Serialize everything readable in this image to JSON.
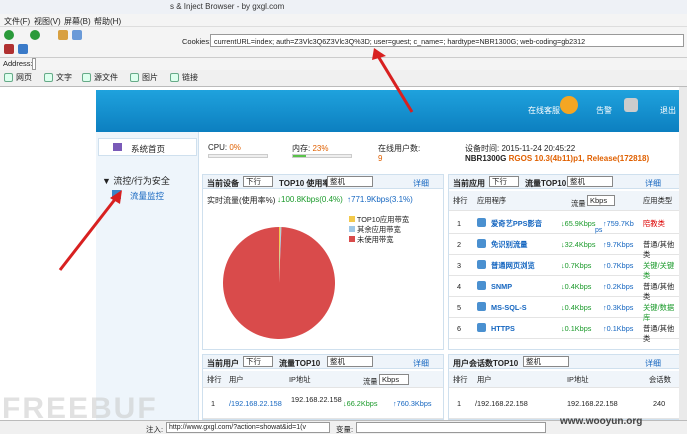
{
  "window_title": "s & Inject Browser - by gxgl.com",
  "menu": [
    "文件(F)",
    "视图(V)",
    "屏幕(B)",
    "帮助(H)"
  ],
  "cookies_label": "Cookies:",
  "cookies_value": "currentURL=index; auth=Z3Vlc3Q6Z3Vlc3Q%3D; user=guest; c_name=; hardtype=NBR1300G; web-coding=gb2312",
  "address_label": "Address:",
  "tabs": [
    "网页",
    "文字",
    "源文件",
    "图片",
    "链接"
  ],
  "banner": {
    "online": "在线客服",
    "alarm": "告警",
    "logout": "退出"
  },
  "sidebar": {
    "home": "系统首页",
    "section": "流控/行为安全",
    "item": "流量监控"
  },
  "stats": {
    "cpu_label": "CPU:",
    "cpu_val": "0%",
    "mem_label": "内存:",
    "mem_val": "23%",
    "users_label": "在线用户数:",
    "users_val": "9",
    "time_label": "设备时间:",
    "time_val": "2015-11-24 20:45:22",
    "model": "NBR1300G",
    "version": "RGOS 10.3(4b11)p1, Release(172818)"
  },
  "progress": {
    "cpu": 0,
    "mem": 23
  },
  "p1": {
    "title": "当前设备",
    "sel1": "下行",
    "top": "TOP10 使用率",
    "sel2": "整机",
    "detail": "详细",
    "realtime": "实时流量(使用率%)",
    "down": "↓100.8Kbps(0.4%)",
    "up": "↑771.9Kbps(3.1%)",
    "legend": [
      "TOP10应用带宽",
      "其余应用带宽",
      "未使用带宽"
    ],
    "legend_colors": [
      "#f2c94c",
      "#9ec7e6",
      "#d94b4b"
    ],
    "pie": [
      0.4,
      0.3,
      99.3
    ]
  },
  "p2": {
    "title": "当前应用",
    "sel1": "下行",
    "top": "流量TOP10",
    "sel2": "整机",
    "detail": "详细",
    "h_rank": "排行",
    "h_app": "应用程序",
    "h_flow": "流量",
    "h_unit": "Kbps",
    "h_type": "应用类型",
    "rows": [
      {
        "rank": "1",
        "app": "爱奇艺PPS影音",
        "down": "↓65.9Kbps",
        "up": "↑759.7Kb",
        "extra": "ps",
        "type": "陪教类"
      },
      {
        "rank": "2",
        "app": "免识别流量",
        "down": "↓32.4Kbps",
        "up": "↑9.7Kbps",
        "type": "普通/其他类"
      },
      {
        "rank": "3",
        "app": "普通网页浏览",
        "down": "↓0.7Kbps",
        "up": "↑0.7Kbps",
        "type": "关键/关键类"
      },
      {
        "rank": "4",
        "app": "SNMP",
        "down": "↓0.4Kbps",
        "up": "↑0.2Kbps",
        "type": "普通/其他类"
      },
      {
        "rank": "5",
        "app": "MS-SQL-S",
        "down": "↓0.4Kbps",
        "up": "↑0.3Kbps",
        "type": "关键/数据库"
      },
      {
        "rank": "6",
        "app": "HTTPS",
        "down": "↓0.1Kbps",
        "up": "↑0.1Kbps",
        "type": "普通/其他类"
      }
    ]
  },
  "p3": {
    "title": "当前用户",
    "sel1": "下行",
    "top": "流量TOP10",
    "sel2": "整机",
    "detail": "详细",
    "h_rank": "排行",
    "h_user": "用户",
    "h_ip": "IP地址",
    "h_flow": "流量",
    "h_unit": "Kbps",
    "row": {
      "rank": "1",
      "user": "/192.168.22.158",
      "ip": "192.168.22.158",
      "down": "↓66.2Kbps",
      "up": "↑760.3Kbps"
    }
  },
  "p4": {
    "title": "用户会话数TOP10",
    "sel": "整机",
    "detail": "详细",
    "h_rank": "排行",
    "h_user": "用户",
    "h_ip": "IP地址",
    "h_sess": "会话数",
    "row": {
      "rank": "1",
      "user": "/192.168.22.158",
      "ip": "192.168.22.158",
      "sess": "240"
    }
  },
  "status": {
    "inject_label": "注入:",
    "inject_url": "http://www.gxgl.com/?action=showat&id=1(v",
    "var_label": "变量:"
  },
  "watermark": "FREEBUF",
  "watermark2": "www.wooyun.org"
}
